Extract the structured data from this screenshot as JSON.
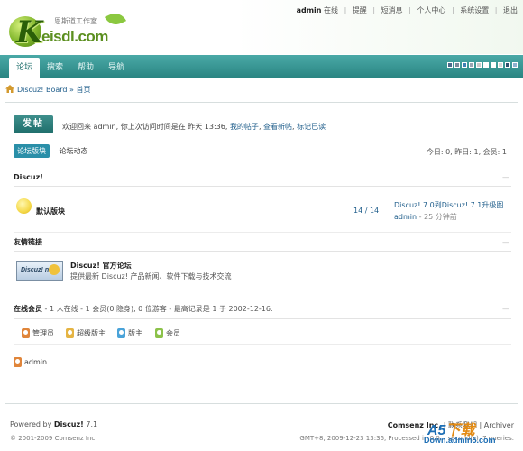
{
  "header": {
    "logo_text": "eisdl.com",
    "logo_sub": "恩斯道工作室",
    "logo_letter": "K",
    "top_links": {
      "user": "admin",
      "status": "在线",
      "remind": "提醒",
      "pm": "短消息",
      "profile": "个人中心",
      "settings": "系统设置",
      "logout": "退出"
    }
  },
  "nav": {
    "tabs": [
      "论坛",
      "搜索",
      "帮助",
      "导航"
    ],
    "swatch_colors": [
      "#4b6a8a",
      "#7a8a9a",
      "#3f7fb4",
      "#9aa6b2",
      "#c9c9c9",
      "#ffffff",
      "#ffffff",
      "#d8d8d8",
      "#2f4f6f",
      "#8fb1cf"
    ]
  },
  "breadcrumb": {
    "board": "Discuz! Board",
    "sep": "»",
    "current": "首页"
  },
  "main": {
    "post_button": "发帖",
    "welcome_text": "欢迎回来 admin, 你上次访问时间是在 昨天 13:36,",
    "welcome_link1": "我的帖子",
    "welcome_link2": "查看新帖",
    "welcome_link3": "标记已读",
    "subtabs": [
      "论坛版块",
      "论坛动态"
    ],
    "stats": "今日: 0, 昨日: 1, 会员: 1",
    "category": "Discuz!",
    "forum": {
      "name": "默认版块",
      "count": "14 / 14",
      "last_post": "Discuz! 7.0到Discuz! 7.1升级图 ...",
      "last_by": "admin",
      "last_ago": "- 25 分钟前"
    },
    "links_head": "友情链接",
    "link": {
      "badge": "Discuz! net",
      "title": "Discuz! 官方论坛",
      "desc": "提供最新 Discuz! 产品新闻、软件下载与技术交流"
    },
    "online": {
      "label": "在线会员",
      "text": "- 1 人在线 - 1 会员(0 隐身), 0 位游客 - 最高记录是 1 于 2002-12-16."
    },
    "legend": [
      {
        "label": "管理员",
        "color": "#e0853a"
      },
      {
        "label": "超级版主",
        "color": "#e5b443"
      },
      {
        "label": "版主",
        "color": "#4aa3d9"
      },
      {
        "label": "会员",
        "color": "#8cc24a"
      }
    ],
    "online_user": "admin"
  },
  "footer": {
    "powered_prefix": "Powered by",
    "powered_name": "Discuz!",
    "powered_ver": "7.1",
    "copyright": "© 2001-2009 Comsenz Inc.",
    "company": "Comsenz Inc.",
    "right_text": "| 联系我们 | Archiver",
    "info": "GMT+8, 2009-12-23 13:36, Processed in 0.0... second(s), 7 queries."
  },
  "watermark": {
    "brand_a": "A5",
    "brand_b": "下载",
    "url": "Down.admin5.com"
  }
}
